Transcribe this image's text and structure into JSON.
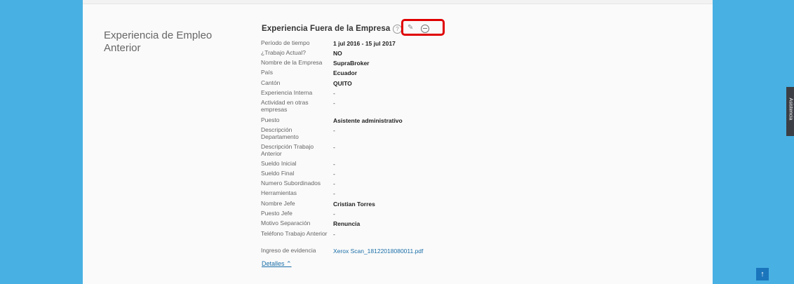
{
  "section_title": "Experiencia de Empleo Anterior",
  "block_title": "Experiencia Fuera de la Empresa",
  "icons": {
    "help": "help-icon",
    "edit": "pencil-icon",
    "history": "history-icon"
  },
  "fields": [
    {
      "label": "Período de tiempo",
      "value": "1 jul 2016 - 15 jul 2017",
      "bold": true
    },
    {
      "label": "¿Trabajo Actual?",
      "value": "NO",
      "bold": true
    },
    {
      "label": "Nombre de la Empresa",
      "value": "SupraBroker",
      "bold": true
    },
    {
      "label": "País",
      "value": "Ecuador",
      "bold": true
    },
    {
      "label": "Cantón",
      "value": "QUITO",
      "bold": true
    },
    {
      "label": "Experiencia Interna",
      "value": "-",
      "bold": false
    },
    {
      "label": "Actividad en otras empresas",
      "value": "-",
      "bold": false
    },
    {
      "label": "Puesto",
      "value": "Asistente administrativo",
      "bold": true
    },
    {
      "label": "Descripción Departamento",
      "value": "-",
      "bold": false
    },
    {
      "label": "Descripción Trabajo Anterior",
      "value": "-",
      "bold": false
    },
    {
      "label": "Sueldo Inicial",
      "value": "-",
      "bold": false
    },
    {
      "label": "Sueldo Final",
      "value": "-",
      "bold": false
    },
    {
      "label": "Numero Subordinados",
      "value": "-",
      "bold": false
    },
    {
      "label": "Herramientas",
      "value": "-",
      "bold": false
    },
    {
      "label": "Nombre Jefe",
      "value": "Cristian Torres",
      "bold": true
    },
    {
      "label": "Puesto Jefe",
      "value": "-",
      "bold": false
    },
    {
      "label": "Motivo Separación",
      "value": "Renuncia",
      "bold": true
    },
    {
      "label": "Teléfono Trabajo Anterior",
      "value": "-",
      "bold": false
    },
    {
      "label": "Ingreso de evidencia",
      "value": "Xerox Scan_18122018080011.pdf",
      "bold": false,
      "link": true
    }
  ],
  "details_link": "Detalles",
  "assist_tab": "Asistencia",
  "scroll_top_label": "↑",
  "colors": {
    "background": "#48b0e3",
    "link": "#1a6ea8",
    "highlight": "#e00000"
  }
}
